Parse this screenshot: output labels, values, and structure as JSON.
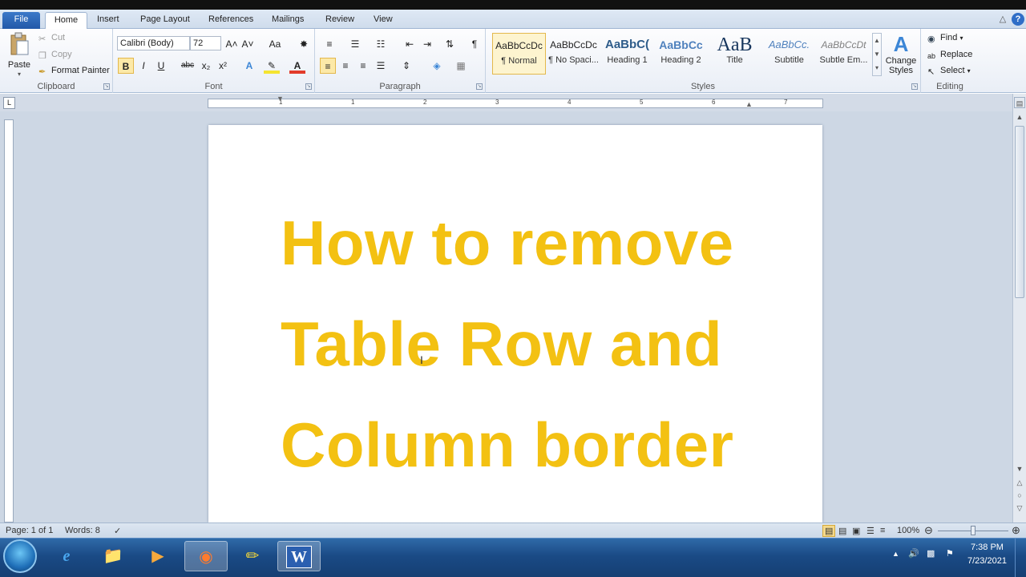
{
  "ribbon_tabs": [
    "File",
    "Home",
    "Insert",
    "Page Layout",
    "References",
    "Mailings",
    "Review",
    "View"
  ],
  "clipboard": {
    "paste": "Paste",
    "cut": "Cut",
    "copy": "Copy",
    "format_painter": "Format Painter",
    "label": "Clipboard"
  },
  "font": {
    "name": "Calibri (Body)",
    "size": "72",
    "label": "Font",
    "bold": "B",
    "italic": "I",
    "underline": "U",
    "strike": "abc",
    "sub": "x₂",
    "sup": "x²",
    "grow": "A˄",
    "shrink": "A˅",
    "case": "Aa"
  },
  "paragraph": {
    "label": "Paragraph",
    "pilcrow": "¶"
  },
  "styles": {
    "label": "Styles",
    "items": [
      {
        "sample": "AaBbCcDc",
        "name": "¶ Normal"
      },
      {
        "sample": "AaBbCcDc",
        "name": "¶ No Spaci..."
      },
      {
        "sample": "AaBbC(",
        "name": "Heading 1"
      },
      {
        "sample": "AaBbCc",
        "name": "Heading 2"
      },
      {
        "sample": "AaB",
        "name": "Title"
      },
      {
        "sample": "AaBbCc.",
        "name": "Subtitle"
      },
      {
        "sample": "AaBbCcDt",
        "name": "Subtle Em..."
      }
    ],
    "change_styles": "Change Styles"
  },
  "editing": {
    "find": "Find",
    "replace": "Replace",
    "select": "Select",
    "label": "Editing"
  },
  "ruler_numbers": [
    "1",
    "1",
    "2",
    "3",
    "4",
    "5",
    "6",
    "7"
  ],
  "document": {
    "lines": [
      "How to remove",
      "Table Row and",
      "Column border"
    ],
    "color": "#f3c112"
  },
  "status": {
    "page": "Page: 1 of 1",
    "words": "Words: 8",
    "zoom": "100%"
  },
  "taskbar": {
    "time": "7:38 PM",
    "date": "7/23/2021"
  }
}
